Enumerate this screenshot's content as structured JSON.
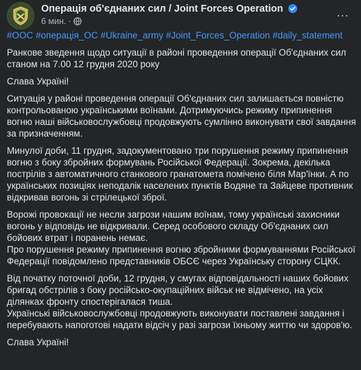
{
  "post": {
    "page_name": "Операція об'єднаних сил / Joint Forces Operation",
    "time": "6 мин.",
    "separator": "·",
    "more_label": "···",
    "hashtags": [
      "#ООС",
      "#операція_ОС",
      "#Ukraine_army",
      "#Joint_Forces_Operation",
      "#daily_statement"
    ],
    "paragraphs": [
      "Ранкове зведення щодо ситуації в районі проведення операції Об'єднаних сил станом на 7.00 12 грудня 2020 року",
      "Слава Україні!",
      "Ситуація у районі проведення операції Об'єднаних сил залишається повністю контрольованою українськими воїнами. Дотримуючись режиму припинення вогню наші військовослужбовці продовжують сумлінно виконувати свої завдання за призначенням.",
      "Минулої доби, 11 грудня, задокументовано три порушення режиму припинення вогню з боку збройних формувань Російської Федерації. Зокрема, декілька пострілів з автоматичного станкового гранатомета помічено біля Мар'їнки. А по українських позиціях неподалік населених пунктів Водяне та Зайцеве противник відкривав вогонь зі стрілецької зброї.",
      "Ворожі провокації не несли загрози нашим воїнам, тому українські захисники вогонь у відповідь не відкривали. Серед особового складу Об'єднаних сил бойових втрат і поранень немає.",
      "Про порушення режиму припинення вогню збройними формуваннями Російської Федерації повідомлено представників ОБСЄ через Українську сторону СЦКК.",
      "Від початку поточної доби, 12 грудня, у смугах відповідальності наших бойових бригад обстрілів з боку російсько-окупаційних військ не відмічено, на усіх ділянках фронту спостерігалася тиша.",
      "Українські військовослужбовці продовжують виконувати поставлені завдання і перебувають напоготові надати відсіч у разі загрози їхньому життю чи здоров'ю.",
      "Слава Україні!"
    ]
  },
  "colors": {
    "background": "#242526",
    "text": "#e4e6eb",
    "secondary_text": "#b0b3b8",
    "hashtag": "#4599ff",
    "verified": "#2d88ff"
  },
  "icons": {
    "avatar": "joint-forces-emblem",
    "verified": "verified-badge-icon",
    "privacy": "globe-icon",
    "more": "more-options-icon"
  }
}
